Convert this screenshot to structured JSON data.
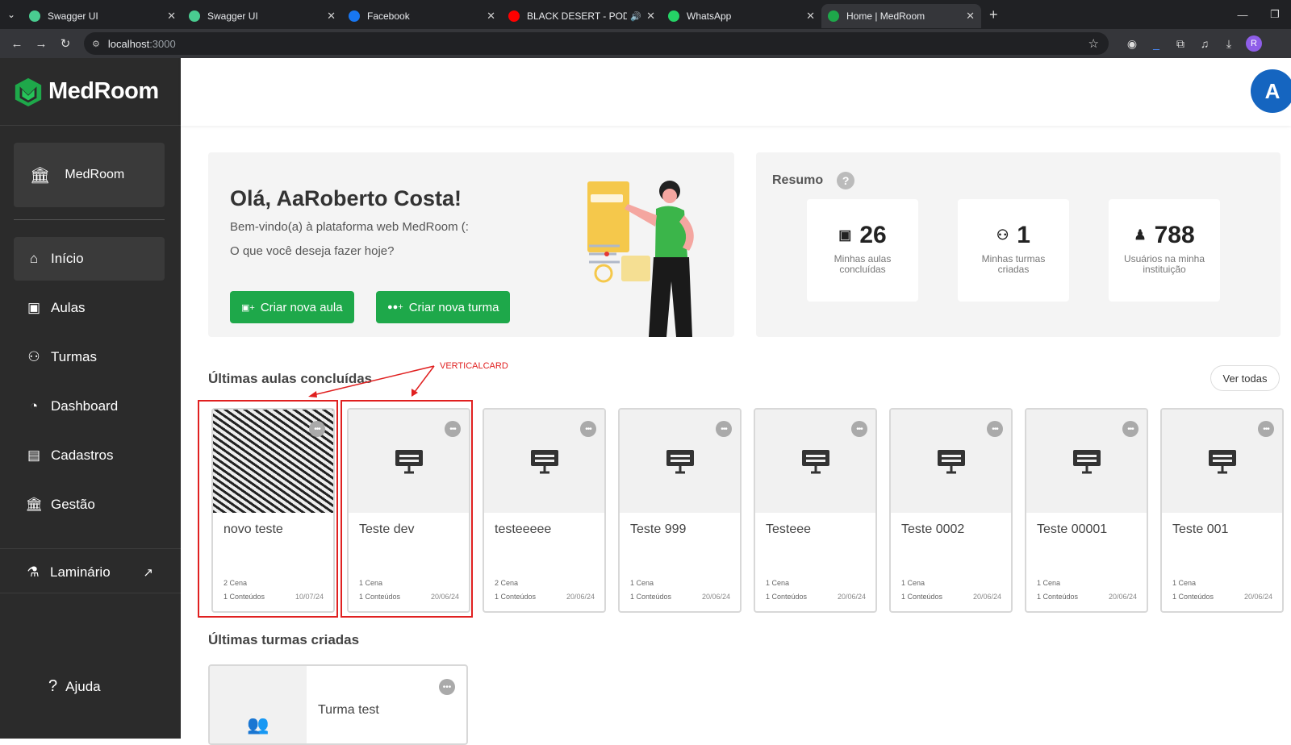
{
  "browser": {
    "tabs": [
      {
        "title": "Swagger UI",
        "favicon_color": "#49cc90"
      },
      {
        "title": "Swagger UI",
        "favicon_color": "#49cc90"
      },
      {
        "title": "Facebook",
        "favicon_color": "#1877f2"
      },
      {
        "title": "BLACK DESERT - PODWAR",
        "favicon_color": "#ff0000"
      },
      {
        "title": "WhatsApp",
        "favicon_color": "#25d366"
      },
      {
        "title": "Home | MedRoom",
        "favicon_color": "#1ea84a",
        "active": true
      }
    ],
    "url_host": "localhost",
    "url_port": ":3000",
    "profile_initial": "R"
  },
  "sidebar": {
    "logo": "MedRoom",
    "institution": "MedRoom",
    "nav": [
      {
        "label": "Início",
        "icon": "home-icon",
        "active": true
      },
      {
        "label": "Aulas",
        "icon": "presentation-icon"
      },
      {
        "label": "Turmas",
        "icon": "users-icon"
      },
      {
        "label": "Dashboard",
        "icon": "pie-chart-icon"
      },
      {
        "label": "Cadastros",
        "icon": "briefcase-icon"
      },
      {
        "label": "Gestão",
        "icon": "institution-icon"
      }
    ],
    "laminario": "Laminário",
    "help": "Ajuda"
  },
  "header": {
    "avatar_initial": "A"
  },
  "welcome": {
    "greeting": "Olá, AaRoberto Costa!",
    "line1": "Bem-vindo(a) à plataforma web MedRoom (:",
    "line2": "O que você deseja fazer hoje?",
    "btn_new_class": "Criar nova aula",
    "btn_new_group": "Criar nova turma"
  },
  "summary": {
    "title": "Resumo",
    "help": "?",
    "stats": [
      {
        "value": "26",
        "label": "Minhas aulas concluídas",
        "icon": "presentation-icon"
      },
      {
        "value": "1",
        "label": "Minhas turmas criadas",
        "icon": "users-icon"
      },
      {
        "value": "788",
        "label": "Usuários na minha instituição",
        "icon": "user-icon"
      }
    ]
  },
  "recent_classes": {
    "title": "Últimas aulas concluídas",
    "see_all": "Ver todas",
    "annotation": "VERTICALCARD",
    "cards": [
      {
        "title": "novo teste",
        "scenes": "2 Cena",
        "contents": "1 Conteúdos",
        "date": "10/07/24",
        "image": true
      },
      {
        "title": "Teste dev",
        "scenes": "1 Cena",
        "contents": "1 Conteúdos",
        "date": "20/06/24"
      },
      {
        "title": "testeeeee",
        "scenes": "2 Cena",
        "contents": "1 Conteúdos",
        "date": "20/06/24"
      },
      {
        "title": "Teste 999",
        "scenes": "1 Cena",
        "contents": "1 Conteúdos",
        "date": "20/06/24"
      },
      {
        "title": "Testeee",
        "scenes": "1 Cena",
        "contents": "1 Conteúdos",
        "date": "20/06/24"
      },
      {
        "title": "Teste 0002",
        "scenes": "1 Cena",
        "contents": "1 Conteúdos",
        "date": "20/06/24"
      },
      {
        "title": "Teste 00001",
        "scenes": "1 Cena",
        "contents": "1 Conteúdos",
        "date": "20/06/24"
      },
      {
        "title": "Teste 001",
        "scenes": "1 Cena",
        "contents": "1 Conteúdos",
        "date": "20/06/24"
      }
    ]
  },
  "recent_groups": {
    "title": "Últimas turmas criadas",
    "cards": [
      {
        "title": "Turma test"
      }
    ]
  },
  "colors": {
    "brand_green": "#1ea84a",
    "sidebar": "#2b2b2b",
    "avatar": "#1565c0",
    "annotation": "#e02020"
  }
}
